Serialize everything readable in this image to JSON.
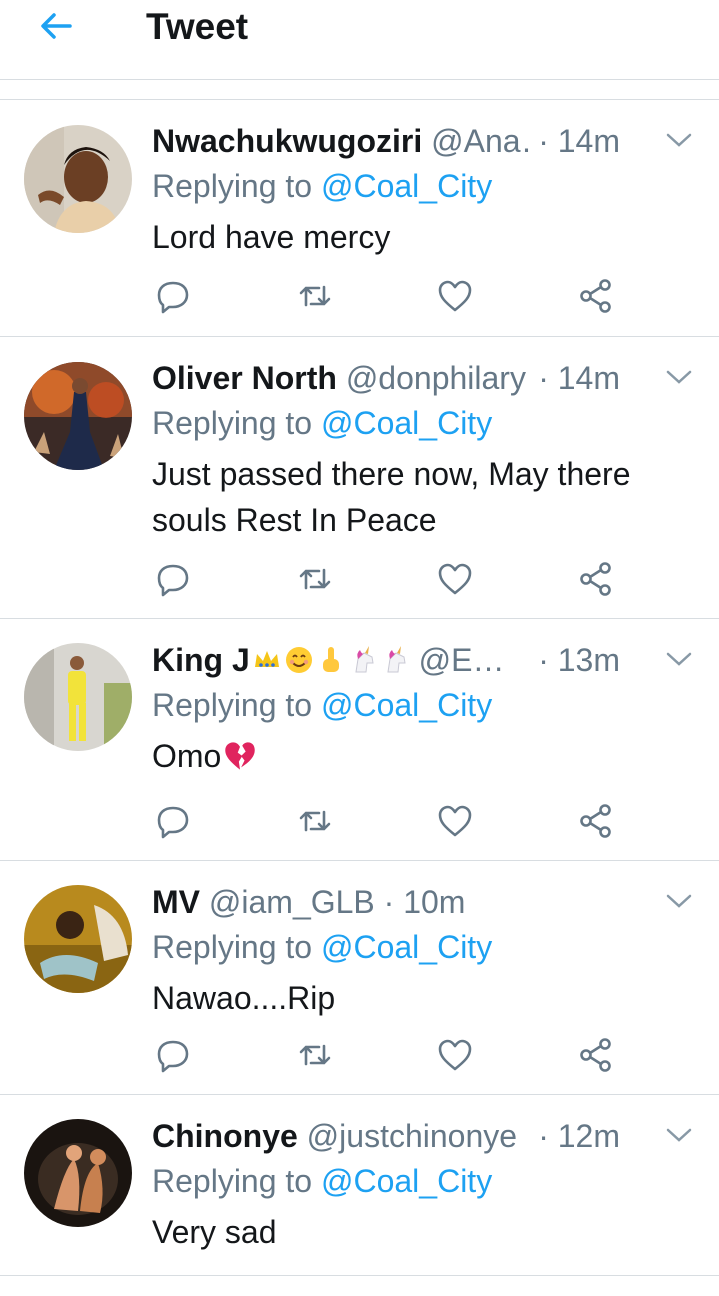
{
  "header": {
    "title": "Tweet",
    "back_icon": "arrow-left-icon"
  },
  "colors": {
    "accent": "#1da1f2",
    "muted": "#657786",
    "text": "#14171a",
    "divider": "#d8dde1"
  },
  "replies": [
    {
      "name": "Nwachukwugoziri",
      "handle": "@Ana…",
      "dot": " · ",
      "time": "14m",
      "replying_label": "Replying to",
      "mention": "@Coal_City",
      "text": "Lord have mercy"
    },
    {
      "name": "Oliver North",
      "handle": "@donphilary",
      "dot": " · ",
      "time": "14m",
      "replying_label": "Replying to",
      "mention": "@Coal_City",
      "text": "Just passed there now, May there souls Rest In Peace"
    },
    {
      "name": "King J",
      "name_emojis": [
        "crown",
        "smiling-face",
        "index-pointing-up",
        "unicorn",
        "unicorn"
      ],
      "handle": "@E…",
      "dot": "",
      "time": "· 13m",
      "replying_label": "Replying to",
      "mention": "@Coal_City",
      "text": "Omo",
      "text_emoji": "broken-heart"
    },
    {
      "name": "MV",
      "handle": "@iam_GLB",
      "dot": " · ",
      "time": "10m",
      "replying_label": "Replying to",
      "mention": "@Coal_City",
      "text": "Nawao....Rip"
    },
    {
      "name": "Chinonye",
      "handle": "@justchinonye",
      "dot": " · ",
      "time": "12m",
      "replying_label": "Replying to",
      "mention": "@Coal_City",
      "text": "Very sad"
    }
  ],
  "action_icons": [
    "reply-icon",
    "retweet-icon",
    "like-icon",
    "share-icon"
  ]
}
